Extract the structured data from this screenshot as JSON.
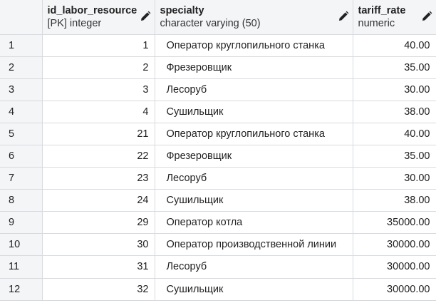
{
  "columns": [
    {
      "name": "id_labor_resource",
      "type": "[PK] integer"
    },
    {
      "name": "specialty",
      "type": "character varying (50)"
    },
    {
      "name": "tariff_rate",
      "type": "numeric"
    }
  ],
  "rows": [
    {
      "row": "1",
      "id": "1",
      "specialty": "Оператор круглопильного станка",
      "tariff": "40.00"
    },
    {
      "row": "2",
      "id": "2",
      "specialty": "Фрезеровщик",
      "tariff": "35.00"
    },
    {
      "row": "3",
      "id": "3",
      "specialty": "Лесоруб",
      "tariff": "30.00"
    },
    {
      "row": "4",
      "id": "4",
      "specialty": "Сушильщик",
      "tariff": "38.00"
    },
    {
      "row": "5",
      "id": "21",
      "specialty": "Оператор круглопильного станка",
      "tariff": "40.00"
    },
    {
      "row": "6",
      "id": "22",
      "specialty": "Фрезеровщик",
      "tariff": "35.00"
    },
    {
      "row": "7",
      "id": "23",
      "specialty": "Лесоруб",
      "tariff": "30.00"
    },
    {
      "row": "8",
      "id": "24",
      "specialty": "Сушильщик",
      "tariff": "38.00"
    },
    {
      "row": "9",
      "id": "29",
      "specialty": "Оператор котла",
      "tariff": "35000.00"
    },
    {
      "row": "10",
      "id": "30",
      "specialty": "Оператор производственной линии",
      "tariff": "30000.00"
    },
    {
      "row": "11",
      "id": "31",
      "specialty": "Лесоруб",
      "tariff": "30000.00"
    },
    {
      "row": "12",
      "id": "32",
      "specialty": "Сушильщик",
      "tariff": "30000.00"
    }
  ]
}
